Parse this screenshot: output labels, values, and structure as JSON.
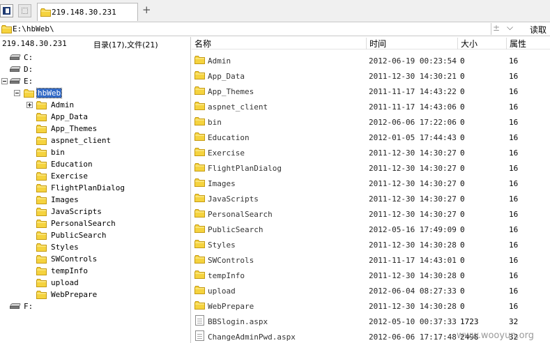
{
  "tab": {
    "title": "219.148.30.231",
    "add_label": "+"
  },
  "address": {
    "path": "E:\\hbWeb\\",
    "plus_glyph": "±",
    "dropdown_glyph": "⌵",
    "read_button": "读取"
  },
  "left": {
    "host": "219.148.30.231",
    "summary": "目录(17),文件(21)",
    "drives_top": [
      "C:",
      "D:",
      "E:"
    ],
    "current": "hbWeb",
    "folders": [
      "Admin",
      "App_Data",
      "App_Themes",
      "aspnet_client",
      "bin",
      "Education",
      "Exercise",
      "FlightPlanDialog",
      "Images",
      "JavaScripts",
      "PersonalSearch",
      "PublicSearch",
      "Styles",
      "SWControls",
      "tempInfo",
      "upload",
      "WebPrepare"
    ],
    "drive_bottom": "F:"
  },
  "right": {
    "columns": {
      "name": "名称",
      "time": "时间",
      "size": "大小",
      "attr": "属性"
    },
    "rows": [
      {
        "type": "folder",
        "name": "Admin",
        "time": "2012-06-19 00:23:54",
        "size": "0",
        "attr": "16"
      },
      {
        "type": "folder",
        "name": "App_Data",
        "time": "2011-12-30 14:30:21",
        "size": "0",
        "attr": "16"
      },
      {
        "type": "folder",
        "name": "App_Themes",
        "time": "2011-11-17 14:43:22",
        "size": "0",
        "attr": "16"
      },
      {
        "type": "folder",
        "name": "aspnet_client",
        "time": "2011-11-17 14:43:06",
        "size": "0",
        "attr": "16"
      },
      {
        "type": "folder",
        "name": "bin",
        "time": "2012-06-06 17:22:06",
        "size": "0",
        "attr": "16"
      },
      {
        "type": "folder",
        "name": "Education",
        "time": "2012-01-05 17:44:43",
        "size": "0",
        "attr": "16"
      },
      {
        "type": "folder",
        "name": "Exercise",
        "time": "2011-12-30 14:30:27",
        "size": "0",
        "attr": "16"
      },
      {
        "type": "folder",
        "name": "FlightPlanDialog",
        "time": "2011-12-30 14:30:27",
        "size": "0",
        "attr": "16"
      },
      {
        "type": "folder",
        "name": "Images",
        "time": "2011-12-30 14:30:27",
        "size": "0",
        "attr": "16"
      },
      {
        "type": "folder",
        "name": "JavaScripts",
        "time": "2011-12-30 14:30:27",
        "size": "0",
        "attr": "16"
      },
      {
        "type": "folder",
        "name": "PersonalSearch",
        "time": "2011-12-30 14:30:27",
        "size": "0",
        "attr": "16"
      },
      {
        "type": "folder",
        "name": "PublicSearch",
        "time": "2012-05-16 17:49:09",
        "size": "0",
        "attr": "16"
      },
      {
        "type": "folder",
        "name": "Styles",
        "time": "2011-12-30 14:30:28",
        "size": "0",
        "attr": "16"
      },
      {
        "type": "folder",
        "name": "SWControls",
        "time": "2011-11-17 14:43:01",
        "size": "0",
        "attr": "16"
      },
      {
        "type": "folder",
        "name": "tempInfo",
        "time": "2011-12-30 14:30:28",
        "size": "0",
        "attr": "16"
      },
      {
        "type": "folder",
        "name": "upload",
        "time": "2012-06-04 08:27:33",
        "size": "0",
        "attr": "16"
      },
      {
        "type": "folder",
        "name": "WebPrepare",
        "time": "2011-12-30 14:30:28",
        "size": "0",
        "attr": "16"
      },
      {
        "type": "file",
        "name": "BBSlogin.aspx",
        "time": "2012-05-10 00:37:33",
        "size": "1723",
        "attr": "32"
      },
      {
        "type": "file",
        "name": "ChangeAdminPwd.aspx",
        "time": "2012-06-06 17:17:48",
        "size": "2498",
        "attr": "32"
      }
    ]
  },
  "watermark": "www.wooyun.org",
  "colors": {
    "selection": "#3169c6",
    "folder": "#f5d33f",
    "folder_edge": "#c49a12"
  }
}
